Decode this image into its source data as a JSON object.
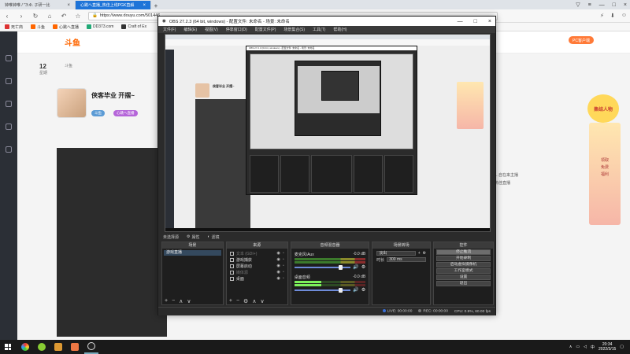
{
  "browser": {
    "tabs": [
      {
        "title": "钟唯钟唯 / \"Э.Ф. 子研一比"
      },
      {
        "title": "心跳へ直播_热佳上线PGK直解"
      }
    ],
    "url": "https://www.douyu.com/501446",
    "bookmarks": [
      "死亡商",
      "斗鱼",
      "心跳へ直播",
      "DD373.com",
      "Craft of Ex"
    ]
  },
  "page": {
    "logo": "斗鱼",
    "stats": [
      {
        "value": "12",
        "label": "星期"
      },
      {
        "value": "",
        "label": "斗鱼"
      }
    ],
    "anchor_name": "侠客毕业 开摆~",
    "badges": [
      "斗鱼",
      "心跳へ直播"
    ],
    "pc_download": "PC客户端",
    "promo_title": "集结人物",
    "promo_lines": [
      "领取",
      "免费",
      "福利"
    ],
    "right_text": [
      "…自在来主播",
      "热佳直播"
    ]
  },
  "obs": {
    "title": "OBS 27.2.3 (64 bit, windows) - 配置文件: 未命名 - 场景: 未命名",
    "menu": [
      "文件(F)",
      "编辑(E)",
      "视图(V)",
      "停靠窗口(D)",
      "配置文件(P)",
      "场景集合(S)",
      "工具(T)",
      "帮助(H)"
    ],
    "bar": {
      "no_source": "未选择源",
      "props": "属性",
      "filters": "滤镜"
    },
    "docks": {
      "scenes": {
        "title": "场景",
        "items": [
          "游戏直播"
        ]
      },
      "sources": {
        "title": "来源",
        "items": [
          {
            "name": "文本 (GDI+)",
            "dim": true
          },
          {
            "name": "游戏捕获",
            "dim": false
          },
          {
            "name": "屏幕启动",
            "dim": false
          },
          {
            "name": "媒体源",
            "dim": true
          },
          {
            "name": "桌面",
            "dim": false
          }
        ]
      },
      "mixer": {
        "title": "音频混音器",
        "channels": [
          {
            "name": "麦克风/Aux",
            "db": "-0.0 dB"
          },
          {
            "name": "桌面音频",
            "db": "-0.0 dB"
          }
        ]
      },
      "transitions": {
        "title": "场景转场",
        "type": "淡出",
        "duration_label": "时长",
        "duration": "300 ms"
      },
      "controls": {
        "title": "控件",
        "buttons": [
          "停止推流",
          "开始录制",
          "启动虚拟摄像机",
          "工作室模式",
          "设置",
          "退出"
        ]
      }
    },
    "status": {
      "live": "LIVE: 00:00:00",
      "rec": "REC: 00:00:00",
      "cpu": "CPU: 0.9%, 60.00 fps"
    }
  },
  "taskbar": {
    "time": "20:34",
    "date": "2022/3/15"
  },
  "colors": {
    "accent": "#1e74d8",
    "douyu_orange": "#ff7a38",
    "obs_bg": "#2b2b2b"
  }
}
